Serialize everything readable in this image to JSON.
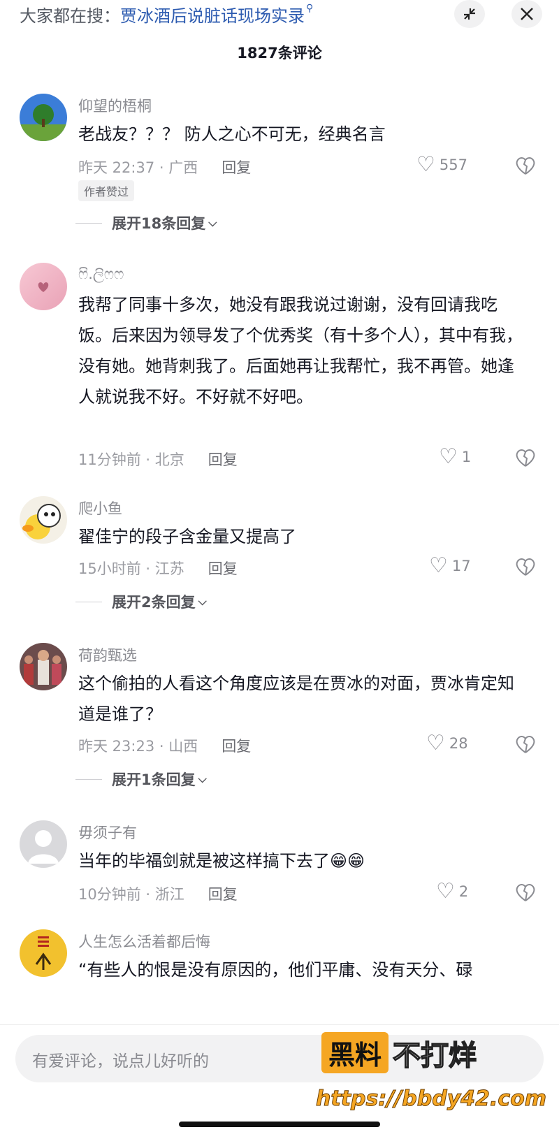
{
  "header": {
    "search_prefix": "大家都在搜：",
    "search_link": "贾冰酒后说脏话现场实录",
    "comment_count": "1827条评论"
  },
  "comments": [
    {
      "username": "仰望的梧桐",
      "text": "老战友？？？ 防人之心不可无，经典名言",
      "meta": "昨天 22:37 · 广西",
      "reply": "回复",
      "likes": "557",
      "badge": "作者赞过",
      "expand": "展开18条回复"
    },
    {
      "username": "ෆි.ලිෆෆ",
      "text": "我帮了同事十多次，她没有跟我说过谢谢，没有回请我吃饭。后来因为领导发了个优秀奖（有十多个人），其中有我，没有她。她背刺我了。后面她再让我帮忙，我不再管。她逢人就说我不好。不好就不好吧。",
      "meta": "11分钟前 · 北京",
      "reply": "回复",
      "likes": "1"
    },
    {
      "username": "爬小鱼",
      "text": "翟佳宁的段子含金量又提高了",
      "meta": "15小时前 · 江苏",
      "reply": "回复",
      "likes": "17",
      "expand": "展开2条回复"
    },
    {
      "username": "荷韵甄选",
      "text": "这个偷拍的人看这个角度应该是在贾冰的对面，贾冰肯定知道是谁了？",
      "meta": "昨天 23:23 · 山西",
      "reply": "回复",
      "likes": "28",
      "expand": "展开1条回复"
    },
    {
      "username": "毋须子有",
      "text": "当年的毕福剑就是被这样搞下去了😁😁",
      "meta": "10分钟前 · 浙江",
      "reply": "回复",
      "likes": "2"
    },
    {
      "username": "人生怎么活着都后悔",
      "text": "“有些人的恨是没有原因的，他们平庸、没有天分、碌"
    }
  ],
  "input": {
    "placeholder": "有爱评论，说点儿好听的"
  },
  "watermark": {
    "brand": "黑料",
    "slogan": "不打烊",
    "url": "https://bbdy42.com"
  },
  "icons": {
    "heart": "heart-icon",
    "dislike": "broken-heart-icon",
    "close": "close-icon",
    "collapse": "collapse-icon",
    "search": "search-icon"
  }
}
